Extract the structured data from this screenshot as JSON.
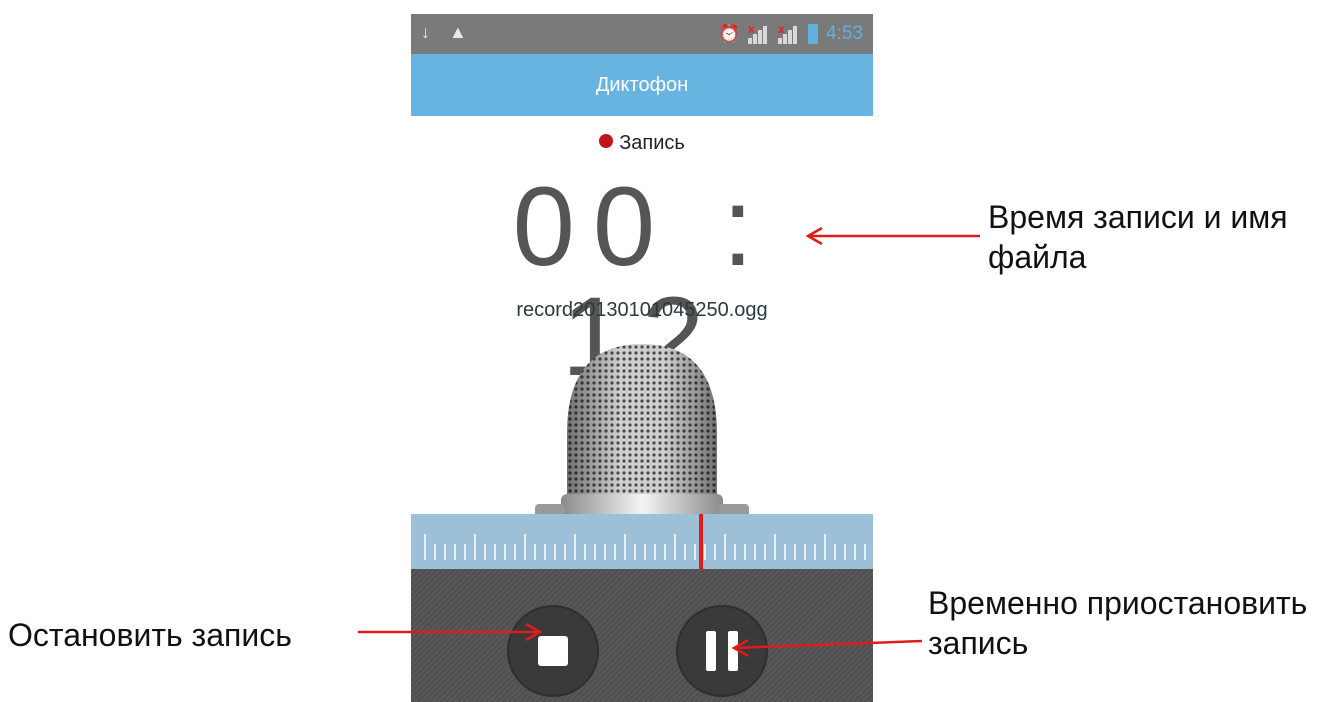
{
  "status_bar": {
    "time": "4:53",
    "left_icons": [
      "usb-icon",
      "warning-icon"
    ],
    "right_icons": [
      "alarm-icon",
      "signal-sim1-icon",
      "signal-sim2-icon",
      "battery-icon"
    ]
  },
  "app": {
    "title": "Диктофон",
    "status_label": "Запись",
    "timer": "00 : 12",
    "file_name": "record20130101045250.ogg"
  },
  "annotations": {
    "time_and_name": "Время записи и имя файла",
    "stop": "Остановить запись",
    "pause": "Временно приостановить запись"
  },
  "colors": {
    "title_bar": "#67b4e1",
    "recording_dot": "#c0131a",
    "arrow": "#e01b1b",
    "controls_bg": "#555555"
  }
}
